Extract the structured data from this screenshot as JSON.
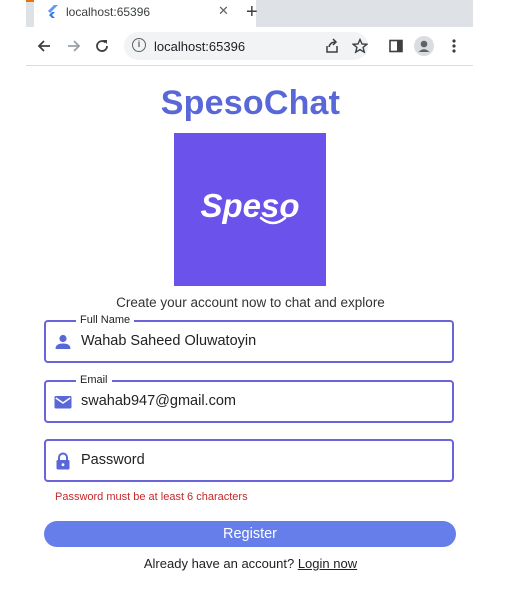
{
  "browser": {
    "tab_title": "localhost:65396",
    "tab_close": "✕",
    "new_tab": "+",
    "window_buttons": [
      "⌄",
      "□",
      "✕"
    ],
    "url": "localhost:65396",
    "info": "i"
  },
  "page": {
    "app_title": "SpesoChat",
    "logo_text": "Speso",
    "logo_color": "#6a52ea",
    "subtitle": "Create your account now to chat and explore",
    "fields": {
      "full_name": {
        "label": "Full Name",
        "value": "Wahab Saheed Oluwatoyin",
        "icon": "person-icon"
      },
      "email": {
        "label": "Email",
        "value": "swahab947@gmail.com",
        "icon": "mail-icon"
      },
      "password": {
        "placeholder": "Password",
        "icon": "lock-icon"
      }
    },
    "error_text": "Password must be at least 6 characters",
    "register_label": "Register",
    "login_prompt": "Already have an account?",
    "login_link": "Login now"
  },
  "colors": {
    "accent": "#5a67d8",
    "button": "#667eea",
    "field_border": "#6a63d9",
    "error": "#c62828"
  }
}
